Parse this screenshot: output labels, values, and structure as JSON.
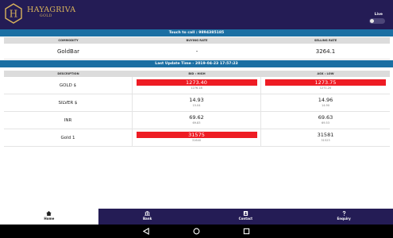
{
  "header": {
    "brand_name": "HAYAGRIVA",
    "brand_sub": "GOLD",
    "live_label": "Live",
    "logo_letter": "H",
    "brand_color": "#d9b35c",
    "bg_color": "#241c55"
  },
  "call_bar": {
    "text": "Touch to call : 9894385185"
  },
  "commodity_table": {
    "headers": [
      "COMMODITY",
      "BUYING RATE",
      "SELLING RATE"
    ],
    "row": {
      "commodity": "GoldBar",
      "buying": "-",
      "selling": "3264.1"
    }
  },
  "update_bar": {
    "text": "Last Update Time - 2019-04-23 17:57:23"
  },
  "rate_table": {
    "headers": [
      "DESCRIPTION",
      "BID : HIGH",
      "ASK : LOW"
    ],
    "rows": [
      {
        "desc": "GOLD $",
        "bid": "1273.40",
        "bid_sub": "1276.18",
        "ask": "1273.75",
        "ask_sub": "1271.20"
      },
      {
        "desc": "SILVER $",
        "bid": "14.93",
        "bid_sub": "15.04",
        "ask": "14.96",
        "ask_sub": "14.90"
      },
      {
        "desc": "INR",
        "bid": "69.62",
        "bid_sub": "69.83",
        "ask": "69.63",
        "ask_sub": "69.53"
      },
      {
        "desc": "Gold 1",
        "bid": "31575",
        "bid_sub": "31640",
        "ask": "31581",
        "ask_sub": "31523"
      }
    ],
    "highlight_color": "#ee1c24"
  },
  "tabs": [
    {
      "label": "Home",
      "icon": "home-icon"
    },
    {
      "label": "Bank",
      "icon": "bank-icon"
    },
    {
      "label": "Contact",
      "icon": "contact-icon"
    },
    {
      "label": "Enquiry",
      "icon": "question-icon"
    }
  ],
  "nav": {
    "buttons": [
      "back-icon",
      "home-circle-icon",
      "recents-icon"
    ]
  }
}
